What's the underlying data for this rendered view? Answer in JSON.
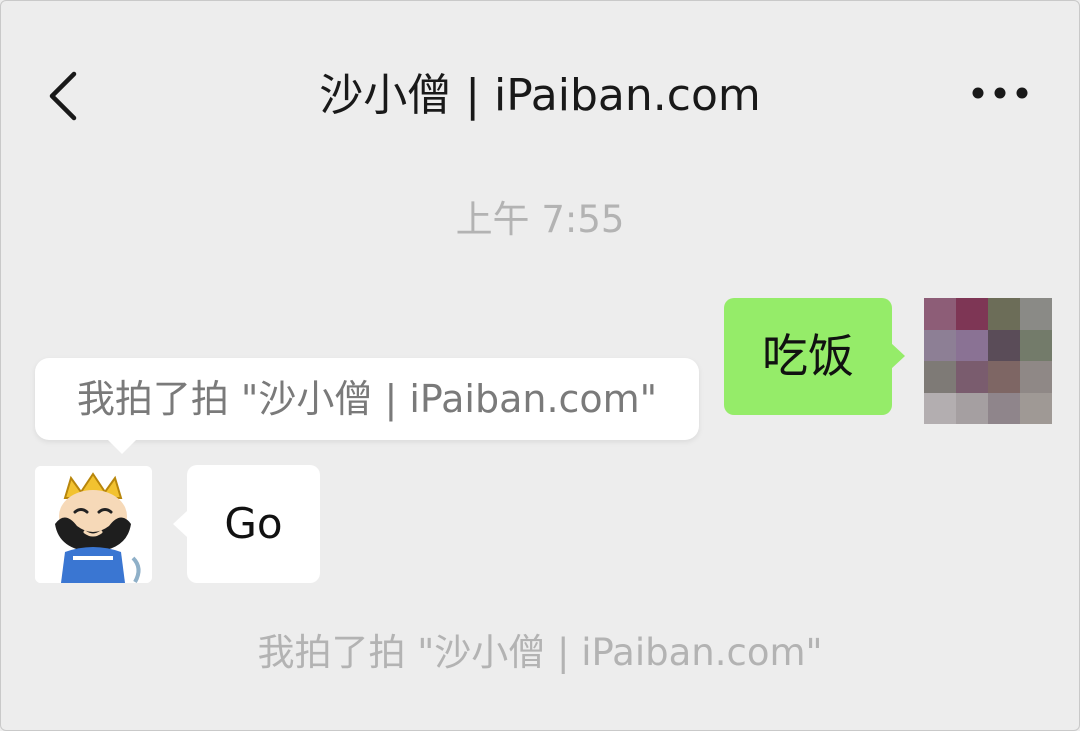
{
  "header": {
    "title": "沙小僧 | iPaiban.com"
  },
  "chat": {
    "timestamp": "上午 7:55",
    "sent_message": "吃饭",
    "pat_tooltip": "我拍了拍 \"沙小僧 | iPaiban.com\"",
    "received_message": "Go",
    "system_message": "我拍了拍 \"沙小僧 | iPaiban.com\""
  },
  "colors": {
    "sent_bubble": "#95ec69",
    "received_bubble": "#ffffff",
    "background": "#ededed",
    "my_avatar_mosaic": [
      "#8d5d77",
      "#7e3655",
      "#6c6d58",
      "#8a8a86",
      "#8d7f95",
      "#8a7294",
      "#5a4c58",
      "#737b6a",
      "#7e7a76",
      "#7a5c6e",
      "#7e6664",
      "#8f8886",
      "#b3aeb0",
      "#a59fa1",
      "#8f858b",
      "#9f9995"
    ]
  }
}
